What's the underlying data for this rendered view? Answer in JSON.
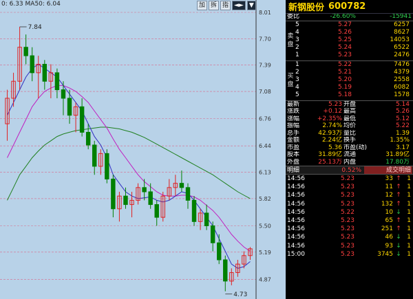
{
  "chart": {
    "legend_text": "0: 6.33  MA50: 6.04",
    "toolbar": [
      "加",
      "拆",
      "指"
    ],
    "y_ticks": [
      "8.01",
      "7.70",
      "7.39",
      "7.08",
      "6.76",
      "6.44",
      "6.13",
      "5.82",
      "5.50",
      "5.19",
      "4.87"
    ],
    "high_label": "7.84",
    "low_label": "4.73",
    "colors": {
      "up": "#e02020",
      "down": "#008000",
      "ma_short": "#3030c0",
      "ma_mid": "#c020c0",
      "ma_long": "#208020"
    }
  },
  "chart_data": {
    "type": "candlestick",
    "ylim": [
      4.72,
      8.01
    ],
    "high": 7.84,
    "low": 4.73,
    "candles": [
      [
        6.7,
        7.1,
        6.5,
        7.0
      ],
      [
        7.0,
        7.3,
        6.9,
        7.2
      ],
      [
        7.2,
        7.84,
        7.1,
        7.6
      ],
      [
        7.6,
        7.75,
        7.4,
        7.5
      ],
      [
        7.5,
        7.6,
        7.2,
        7.3
      ],
      [
        7.3,
        7.5,
        7.0,
        7.4
      ],
      [
        7.4,
        7.45,
        7.1,
        7.2
      ],
      [
        7.2,
        7.4,
        7.0,
        7.3
      ],
      [
        7.3,
        7.35,
        7.0,
        7.1
      ],
      [
        7.1,
        7.2,
        6.8,
        7.0
      ],
      [
        7.0,
        7.1,
        6.7,
        6.8
      ],
      [
        6.8,
        6.95,
        6.6,
        6.9
      ],
      [
        6.9,
        7.0,
        6.55,
        6.6
      ],
      [
        6.6,
        6.7,
        6.4,
        6.45
      ],
      [
        6.45,
        6.5,
        6.1,
        6.2
      ],
      [
        6.2,
        6.4,
        6.1,
        6.35
      ],
      [
        6.35,
        6.4,
        6.0,
        6.05
      ],
      [
        6.05,
        6.1,
        5.6,
        5.7
      ],
      [
        5.7,
        5.9,
        5.55,
        5.85
      ],
      [
        5.85,
        5.95,
        5.7,
        5.75
      ],
      [
        5.75,
        5.9,
        5.6,
        5.8
      ],
      [
        5.8,
        6.0,
        5.75,
        5.95
      ],
      [
        5.95,
        6.05,
        5.8,
        5.9
      ],
      [
        5.9,
        6.0,
        5.7,
        5.75
      ],
      [
        5.75,
        5.8,
        5.5,
        5.6
      ],
      [
        5.6,
        5.9,
        5.55,
        5.85
      ],
      [
        5.85,
        6.05,
        5.8,
        5.95
      ],
      [
        5.95,
        6.1,
        5.85,
        6.0
      ],
      [
        6.0,
        6.15,
        5.9,
        5.95
      ],
      [
        5.95,
        6.0,
        5.7,
        5.8
      ],
      [
        5.8,
        5.85,
        5.5,
        5.55
      ],
      [
        5.55,
        5.7,
        5.45,
        5.65
      ],
      [
        5.65,
        5.75,
        5.45,
        5.5
      ],
      [
        5.5,
        5.55,
        5.2,
        5.3
      ],
      [
        5.3,
        5.4,
        5.05,
        5.1
      ],
      [
        5.1,
        5.15,
        4.73,
        4.85
      ],
      [
        4.85,
        5.0,
        4.8,
        4.95
      ],
      [
        4.95,
        5.1,
        4.9,
        5.05
      ],
      [
        5.05,
        5.2,
        5.0,
        5.15
      ],
      [
        5.15,
        5.25,
        5.1,
        5.23
      ]
    ],
    "ma_short": [
      6.8,
      6.95,
      7.1,
      7.25,
      7.35,
      7.4,
      7.35,
      7.3,
      7.25,
      7.15,
      7.05,
      6.95,
      6.85,
      6.7,
      6.55,
      6.45,
      6.3,
      6.1,
      6.0,
      5.9,
      5.85,
      5.82,
      5.83,
      5.84,
      5.8,
      5.78,
      5.8,
      5.85,
      5.9,
      5.88,
      5.8,
      5.7,
      5.6,
      5.5,
      5.35,
      5.2,
      5.05,
      5.0,
      5.02,
      5.08
    ],
    "ma_mid": [
      6.3,
      6.45,
      6.6,
      6.75,
      6.9,
      7.0,
      7.08,
      7.12,
      7.15,
      7.15,
      7.12,
      7.08,
      7.02,
      6.95,
      6.85,
      6.75,
      6.65,
      6.52,
      6.4,
      6.3,
      6.2,
      6.1,
      6.02,
      5.96,
      5.9,
      5.86,
      5.85,
      5.85,
      5.86,
      5.86,
      5.84,
      5.8,
      5.74,
      5.68,
      5.6,
      5.5,
      5.4,
      5.32,
      5.25,
      5.2
    ],
    "ma_long": [
      5.8,
      5.95,
      6.1,
      6.2,
      6.3,
      6.38,
      6.45,
      6.5,
      6.55,
      6.58,
      6.6,
      6.62,
      6.63,
      6.64,
      6.65,
      6.66,
      6.66,
      6.65,
      6.64,
      6.62,
      6.6,
      6.57,
      6.54,
      6.5,
      6.46,
      6.42,
      6.38,
      6.34,
      6.3,
      6.26,
      6.22,
      6.18,
      6.14,
      6.1,
      6.05,
      6.0,
      5.95,
      5.9,
      5.86,
      5.82
    ]
  },
  "quote": {
    "name": "新钢股份",
    "code": "600782",
    "webi": {
      "label": "委比",
      "pct": "-26.60%",
      "diff": "-15941"
    },
    "asks": [
      {
        "level": "5",
        "price": "5.27",
        "vol": "6257"
      },
      {
        "level": "4",
        "price": "5.26",
        "vol": "8627"
      },
      {
        "level": "3",
        "price": "5.25",
        "vol": "14053"
      },
      {
        "level": "2",
        "price": "5.24",
        "vol": "6522"
      },
      {
        "level": "1",
        "price": "5.23",
        "vol": "2476"
      }
    ],
    "bids": [
      {
        "level": "1",
        "price": "5.22",
        "vol": "7476"
      },
      {
        "level": "2",
        "price": "5.21",
        "vol": "4379"
      },
      {
        "level": "3",
        "price": "5.20",
        "vol": "2558"
      },
      {
        "level": "4",
        "price": "5.19",
        "vol": "6082"
      },
      {
        "level": "5",
        "price": "5.18",
        "vol": "1578"
      }
    ],
    "ask_side_label": "卖盘",
    "bid_side_label": "买盘",
    "stats": [
      [
        "最新",
        "5.23",
        "开盘",
        "5.14"
      ],
      [
        "涨跌",
        "+0.12",
        "最高",
        "5.26"
      ],
      [
        "涨幅",
        "+2.35%",
        "最低",
        "5.12"
      ],
      [
        "振幅",
        "2.74%",
        "均价",
        "5.22"
      ],
      [
        "总手",
        "42.93万",
        "量比",
        "1.39"
      ],
      [
        "金额",
        "2.24亿",
        "换手",
        "1.35%"
      ],
      [
        "市盈",
        "5.36",
        "市盈(动)",
        "3.17"
      ],
      [
        "股本",
        "31.89亿",
        "流通",
        "31.89亿"
      ],
      [
        "外盘",
        "25.13万",
        "内盘",
        "17.80万"
      ]
    ],
    "ticks_header": {
      "label": "明细",
      "pct": "0.52%",
      "tag": "成交明细"
    },
    "ticks": [
      {
        "time": "14:56",
        "price": "5.23",
        "vol": "33",
        "dir": "up",
        "num": "1"
      },
      {
        "time": "14:56",
        "price": "5.23",
        "vol": "11",
        "dir": "up",
        "num": "1"
      },
      {
        "time": "14:56",
        "price": "5.23",
        "vol": "12",
        "dir": "up",
        "num": "1"
      },
      {
        "time": "14:56",
        "price": "5.23",
        "vol": "132",
        "dir": "up",
        "num": "1"
      },
      {
        "time": "14:56",
        "price": "5.22",
        "vol": "10",
        "dir": "down",
        "num": "1"
      },
      {
        "time": "14:56",
        "price": "5.23",
        "vol": "65",
        "dir": "up",
        "num": "1"
      },
      {
        "time": "14:56",
        "price": "5.23",
        "vol": "251",
        "dir": "up",
        "num": "1"
      },
      {
        "time": "14:56",
        "price": "5.23",
        "vol": "46",
        "dir": "down",
        "num": "1"
      },
      {
        "time": "14:56",
        "price": "5.23",
        "vol": "93",
        "dir": "down",
        "num": "1"
      },
      {
        "time": "15:00",
        "price": "5.23",
        "vol": "3745",
        "dir": "down",
        "num": "1"
      }
    ]
  }
}
